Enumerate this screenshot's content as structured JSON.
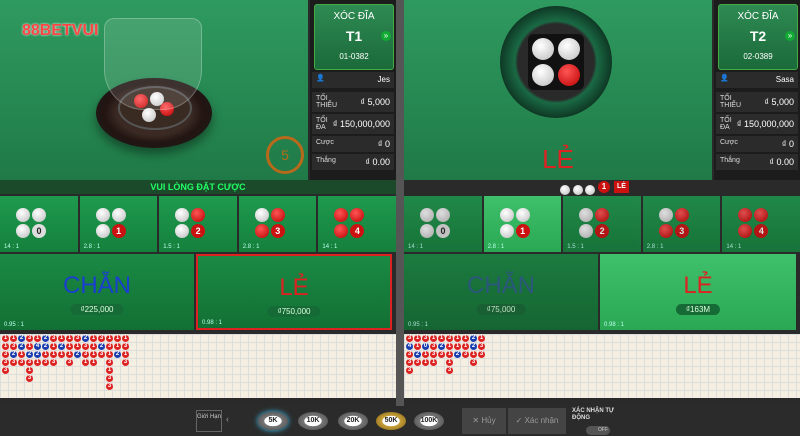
{
  "brand": {
    "logo": "88BETVUI"
  },
  "left": {
    "table": {
      "game": "XÓC ĐĨA",
      "id": "T1",
      "round": "01-0382"
    },
    "dealer": "Jes",
    "min_label": "TỐI THIỂU",
    "min": "₫ 5,000",
    "max_label": "TỐI ĐA",
    "max": "₫ 150,000,000",
    "bet_label": "Cược",
    "bet": "₫ 0",
    "win_label": "Thắng",
    "win": "₫ 0.00",
    "timer": "5",
    "status": "VUI LÒNG ĐẶT CƯỢC",
    "cells": [
      {
        "odds": "14 : 1",
        "n": "0"
      },
      {
        "odds": "2.8 : 1",
        "n": "1"
      },
      {
        "odds": "1.5 : 1",
        "n": "2"
      },
      {
        "odds": "2.8 : 1",
        "n": "3"
      },
      {
        "odds": "14 : 1",
        "n": "4"
      }
    ],
    "chan": {
      "label": "CHẴN",
      "amount": "₫225,000",
      "odds": "0.95 : 1"
    },
    "le": {
      "label": "LẺ",
      "amount": "₫750,000",
      "odds": "0.98 : 1"
    }
  },
  "right": {
    "table": {
      "game": "XÓC ĐĨA",
      "id": "T2",
      "round": "02-0389"
    },
    "dealer": "Sasa",
    "min_label": "TỐI THIỂU",
    "min": "₫ 5,000",
    "max_label": "TỐI ĐA",
    "max": "₫ 150,000,000",
    "bet_label": "Cược",
    "bet": "₫ 0",
    "win_label": "Thắng",
    "win": "₫ 0.00",
    "result": "LẺ",
    "result_count": "1",
    "result_tag": "LẺ",
    "cells": [
      {
        "odds": "14 : 1",
        "n": "0"
      },
      {
        "odds": "2.8 : 1",
        "n": "1"
      },
      {
        "odds": "1.5 : 1",
        "n": "2"
      },
      {
        "odds": "2.8 : 1",
        "n": "3"
      },
      {
        "odds": "14 : 1",
        "n": "4"
      }
    ],
    "chan": {
      "label": "CHẴN",
      "amount": "₫75,000",
      "odds": "0.95 : 1"
    },
    "le": {
      "label": "LẺ",
      "amount": "₫163M",
      "odds": "0.98 : 1"
    }
  },
  "toolbar": {
    "limit_label": "Giới Hạn",
    "chips": [
      "5K",
      "10K",
      "20K",
      "50K",
      "100K"
    ],
    "cancel": "Hủy",
    "confirm": "Xác nhận",
    "auto_label": "XÁC NHẬN TỰ ĐỘNG",
    "auto_state": "OFF"
  },
  "roadL": [
    [
      "1",
      "1",
      "3",
      "3",
      "3"
    ],
    [
      "1",
      "3",
      "2",
      "3"
    ],
    [
      "2",
      "2",
      "1",
      "3"
    ],
    [
      "3",
      "1",
      "2",
      "3",
      "1",
      "3"
    ],
    [
      "1",
      "4",
      "2",
      "1"
    ],
    [
      "2",
      "2",
      "1",
      "3"
    ],
    [
      "3",
      "1",
      "1",
      "3"
    ],
    [
      "1",
      "2",
      "1"
    ],
    [
      "1",
      "1",
      "1",
      "3"
    ],
    [
      "3",
      "1",
      "2"
    ],
    [
      "2",
      "3",
      "3",
      "1"
    ],
    [
      "1",
      "1",
      "1",
      "1"
    ],
    [
      "3",
      "2",
      "3"
    ],
    [
      "1",
      "3",
      "1",
      "3",
      "1",
      "3",
      "3"
    ],
    [
      "1",
      "1",
      "2"
    ],
    [
      "1",
      "3",
      "1",
      "3"
    ]
  ],
  "roadR": [
    [
      "3",
      "4",
      "3",
      "3",
      "3"
    ],
    [
      "1",
      "1",
      "2",
      "3"
    ],
    [
      "3",
      "0",
      "1",
      "1"
    ],
    [
      "1",
      "3",
      "3",
      "1"
    ],
    [
      "1",
      "2",
      "3"
    ],
    [
      "3",
      "1",
      "1",
      "1",
      "3"
    ],
    [
      "1",
      "1",
      "2"
    ],
    [
      "1",
      "1",
      "3"
    ],
    [
      "2",
      "2",
      "1",
      "3"
    ],
    [
      "1",
      "3",
      "3"
    ]
  ],
  "colors": {
    "red": "#d22",
    "blue": "#1b3fb0"
  }
}
